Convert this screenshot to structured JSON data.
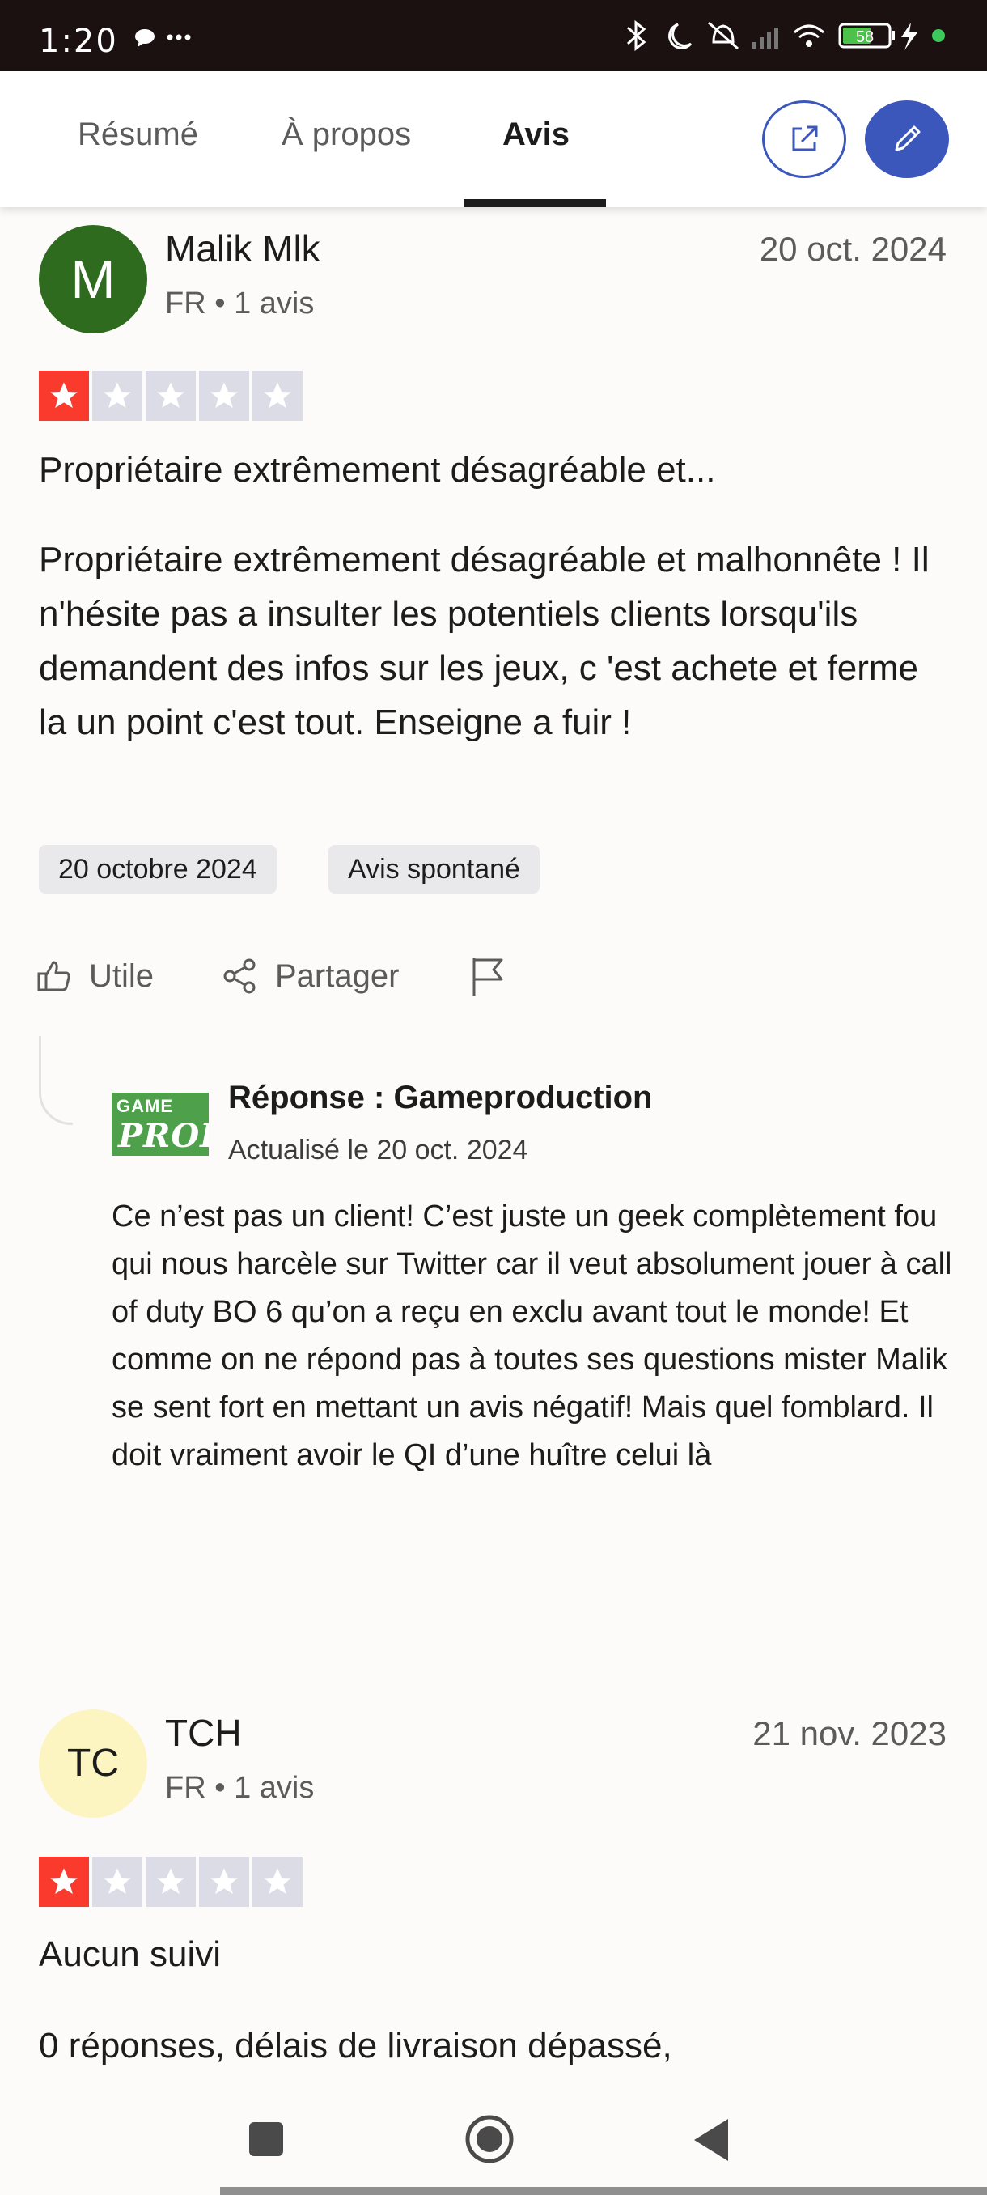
{
  "status_bar": {
    "time": "1:20",
    "battery": "58"
  },
  "tabs": [
    {
      "label": "Résumé",
      "active": false
    },
    {
      "label": "À propos",
      "active": false
    },
    {
      "label": "Avis",
      "active": true
    }
  ],
  "toolbar": {
    "open_external_icon": "external-link-icon",
    "edit_icon": "pencil-icon"
  },
  "reviews": [
    {
      "avatar_initials": "M",
      "avatar_color": "#2f6b1f",
      "name": "Malik Mlk",
      "meta": "FR • 1 avis",
      "date": "20 oct. 2024",
      "rating": 1,
      "max_rating": 5,
      "title": "Propriétaire extrêmement désagréable et...",
      "body": "Propriétaire extrêmement désagréable et malhonnête ! Il n'hésite pas a insulter les potentiels clients lorsqu'ils demandent des infos sur les jeux, c 'est achete et ferme la un point c'est tout. Enseigne a fuir !",
      "chips": [
        "20 octobre 2024",
        "Avis spontané"
      ],
      "actions": {
        "useful": "Utile",
        "share": "Partager"
      },
      "reply": {
        "logo_top": "GAME",
        "logo_bottom": "PROD",
        "title": "Réponse : Gameproduction",
        "updated": "Actualisé le 20 oct. 2024",
        "body": "Ce n’est pas un client! C’est juste un geek complètement fou qui nous harcèle sur Twitter car il veut absolument jouer à call of duty BO 6 qu’on a reçu en exclu avant tout le monde! Et comme on ne répond pas à toutes ses questions mister Malik se sent fort en mettant un avis négatif! Mais quel fomblard. Il doit vraiment avoir le QI d’une huître celui là"
      }
    },
    {
      "avatar_initials": "TC",
      "avatar_color": "#fcf5c2",
      "name": "TCH",
      "meta": "FR • 1 avis",
      "date": "21 nov. 2023",
      "rating": 1,
      "max_rating": 5,
      "title": "Aucun suivi",
      "body": "0 réponses, délais de livraison dépassé,"
    }
  ],
  "colors": {
    "accent": "#3c57bc",
    "star_active": "#fb3a2e",
    "star_inactive": "#dcdce6"
  }
}
